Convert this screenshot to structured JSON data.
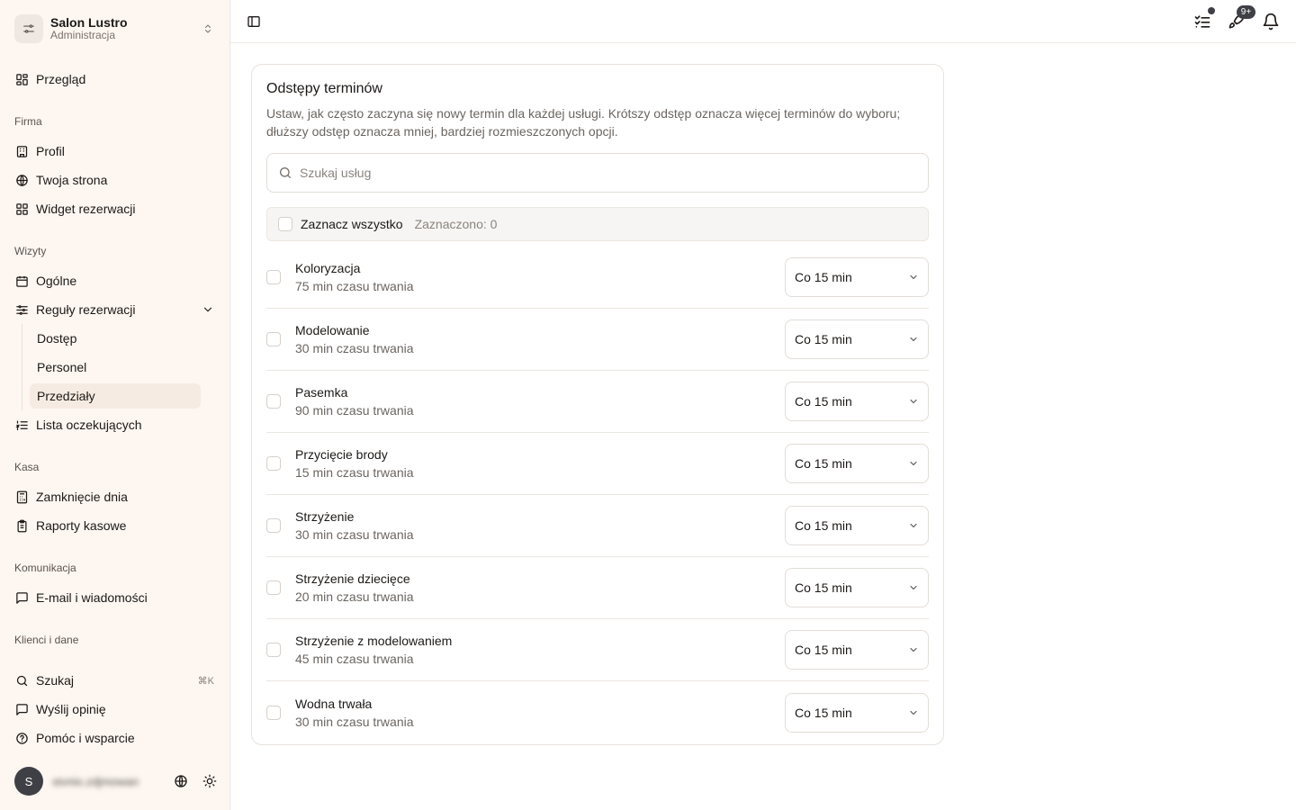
{
  "org": {
    "name": "Salon Lustro",
    "subtitle": "Administracja"
  },
  "nav": {
    "overview": "Przegląd",
    "sections": {
      "firma": "Firma",
      "wizyty": "Wizyty",
      "kasa": "Kasa",
      "komunikacja": "Komunikacja",
      "klienci": "Klienci i dane"
    },
    "profile": "Profil",
    "website": "Twoja strona",
    "widget": "Widget rezerwacji",
    "general": "Ogólne",
    "booking_rules": "Reguły rezerwacji",
    "sub_access": "Dostęp",
    "sub_staff": "Personel",
    "sub_intervals": "Przedziały",
    "waitlist": "Lista oczekujących",
    "day_close": "Zamknięcie dnia",
    "cash_reports": "Raporty kasowe",
    "email": "E-mail i wiadomości",
    "search": "Szukaj",
    "search_shortcut": "⌘K",
    "feedback": "Wyślij opinię",
    "help": "Pomóc i wsparcie"
  },
  "user": {
    "initial": "S",
    "email": "stvnio.zdjmowan"
  },
  "topbar": {
    "badge": "9+"
  },
  "card": {
    "title": "Odstępy terminów",
    "description": "Ustaw, jak często zaczyna się nowy termin dla każdej usługi. Krótszy odstęp oznacza więcej terminów do wyboru; dłuższy odstęp oznacza mniej, bardziej rozmieszczonych opcji.",
    "search_placeholder": "Szukaj usług",
    "select_all": "Zaznacz wszystko",
    "selected_count": "Zaznaczono: 0"
  },
  "services": [
    {
      "name": "Koloryzacja",
      "duration": "75 min czasu trwania",
      "interval": "Co 15 min"
    },
    {
      "name": "Modelowanie",
      "duration": "30 min czasu trwania",
      "interval": "Co 15 min"
    },
    {
      "name": "Pasemka",
      "duration": "90 min czasu trwania",
      "interval": "Co 15 min"
    },
    {
      "name": "Przycięcie brody",
      "duration": "15 min czasu trwania",
      "interval": "Co 15 min"
    },
    {
      "name": "Strzyżenie",
      "duration": "30 min czasu trwania",
      "interval": "Co 15 min"
    },
    {
      "name": "Strzyżenie dziecięce",
      "duration": "20 min czasu trwania",
      "interval": "Co 15 min"
    },
    {
      "name": "Strzyżenie z modelowaniem",
      "duration": "45 min czasu trwania",
      "interval": "Co 15 min"
    },
    {
      "name": "Wodna trwała",
      "duration": "30 min czasu trwania",
      "interval": "Co 15 min"
    }
  ]
}
